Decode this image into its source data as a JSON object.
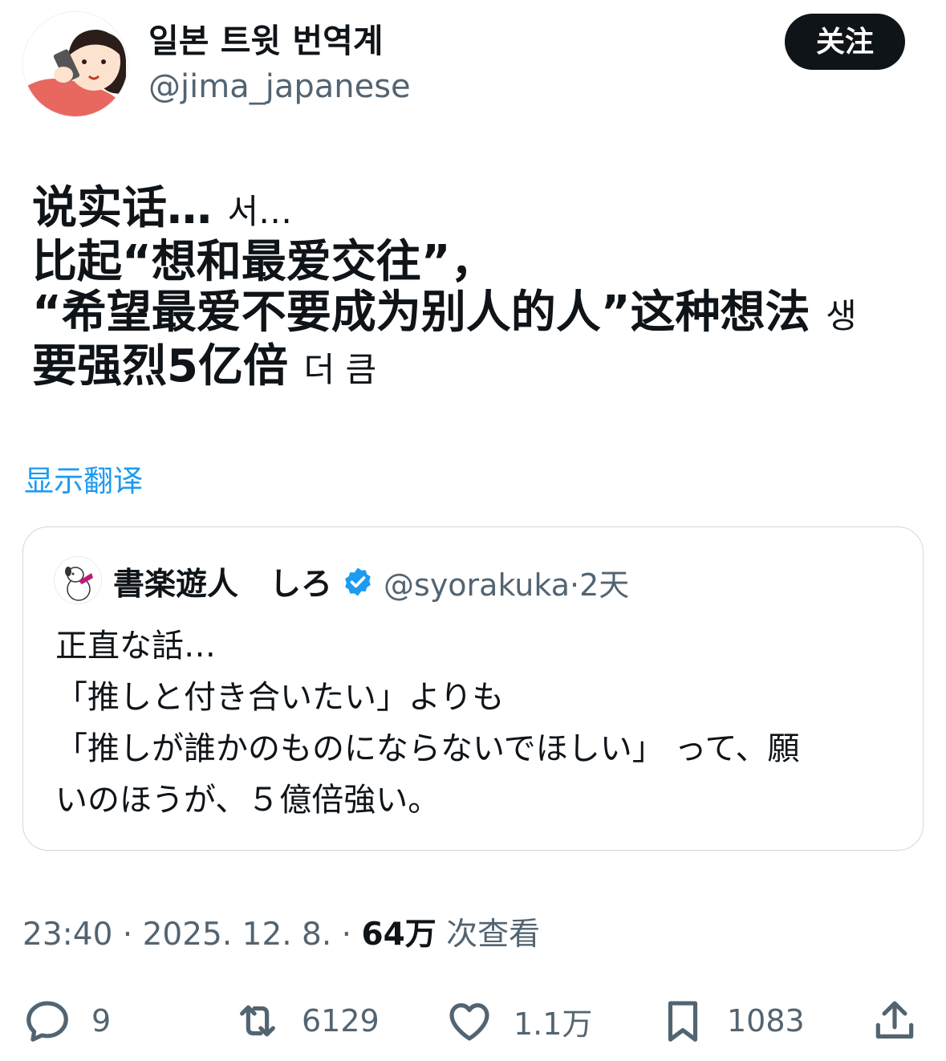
{
  "author": {
    "display_name": "일본 트윗 번역계",
    "handle": "@jima_japanese",
    "follow_label": "关注",
    "avatar_icon": "woman-on-phone-illustration"
  },
  "tweet": {
    "lines": [
      {
        "main": "说实话…",
        "kr": "서…"
      },
      {
        "main": "比起“想和最爱交往”，",
        "kr": ""
      },
      {
        "main": "“希望最爱不要成为别人的人”这种想法",
        "kr": "생"
      },
      {
        "main": "要强烈5亿倍",
        "kr": "더 큼"
      }
    ],
    "show_translation": "显示翻译"
  },
  "quote": {
    "display_name": "書楽遊人　しろ",
    "handle": "@syorakuka·2天",
    "verified_icon": "verified-badge-icon",
    "lines": [
      "正直な話…",
      "「推しと付き合いたい」よりも",
      "「推しが誰かのものにならないでほしい」 って、願",
      "いのほうが、５億倍強い。"
    ]
  },
  "meta": {
    "time_date": "23:40 · 2025. 12. 8. · ",
    "views_count": "64万",
    "views_label": " 次查看"
  },
  "actions": {
    "reply_count": "9",
    "retweet_count": "6129",
    "like_count": "1.1万",
    "bookmark_count": "1083"
  },
  "colors": {
    "accent": "#1d9bf0",
    "text": "#0f1419",
    "secondary": "#536471",
    "border": "#cfd9de",
    "button": "#0f1419"
  }
}
